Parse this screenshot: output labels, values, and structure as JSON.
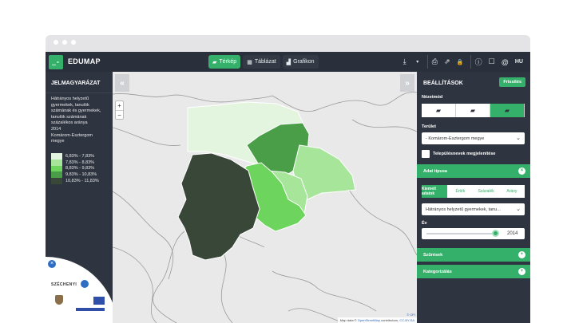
{
  "app": {
    "logo_glyph": "_-",
    "brand": "EDUMAP"
  },
  "view_tabs": [
    {
      "label": "Térkép",
      "icon": "map-icon",
      "active": true
    },
    {
      "label": "Táblázat",
      "icon": "table-icon",
      "active": false
    },
    {
      "label": "Grafikon",
      "icon": "bar-chart-icon",
      "active": false
    }
  ],
  "toolbar": {
    "download": "⤓",
    "dropdown": "▾",
    "print": "⎙",
    "share": "⇗",
    "lock": "🔒",
    "info": "ⓘ",
    "comment": "☐",
    "email": "@",
    "lang": "HU"
  },
  "legend": {
    "title": "JELMAGYARÁZAT",
    "description_lines": [
      "Hátrányos helyzetű",
      "gyermekek, tanulók",
      "számának és gyermekek,",
      "tanulók számának",
      "százalékos aránya",
      "2014",
      "Komárom-Esztergom",
      "megye"
    ],
    "items": [
      {
        "label": "6,83% - 7,83%",
        "color": "#e3f5de"
      },
      {
        "label": "7,83% - 8,83%",
        "color": "#a6e59a"
      },
      {
        "label": "8,83% - 9,83%",
        "color": "#6dd55e"
      },
      {
        "label": "9,83% - 10,83%",
        "color": "#4a9e48"
      },
      {
        "label": "10,83% - 11,83%",
        "color": "#384737"
      }
    ]
  },
  "badge": {
    "close": "×",
    "text": "SZÉCHENYI"
  },
  "map": {
    "collapse_left": "«",
    "collapse_right": "»",
    "zoom_in": "+",
    "zoom_out": "−",
    "attribution_prefix": "Map data ©",
    "attribution_link": "OpenStreetMap",
    "attribution_suffix": "contributors,",
    "license_link": "CC-BY-SA",
    "ofi": "© OFI"
  },
  "settings": {
    "title": "BEÁLLÍTÁSOK",
    "refresh": "Frissítés",
    "view_mode_label": "Nézetmód",
    "area_label": "Terület",
    "area_value": "- Komárom-Esztergom megye",
    "show_names_label": "Településnevek megjelenítése",
    "data_type_label": "Adat típusa",
    "data_tabs": [
      {
        "label": "Kiemelt adatok",
        "active": true
      },
      {
        "label": "Érték",
        "active": false
      },
      {
        "label": "Százalék",
        "active": false
      },
      {
        "label": "Arány",
        "active": false
      }
    ],
    "indicator_value": "Hátrányos helyzetű gyermekek, tanu...",
    "year_label": "Év",
    "year_value": "2014",
    "year_fraction": 0.95,
    "filters_label": "Szűrések",
    "categories_label": "Kategorizálás",
    "plus": "+",
    "close": "×",
    "chevron": "⌄"
  }
}
